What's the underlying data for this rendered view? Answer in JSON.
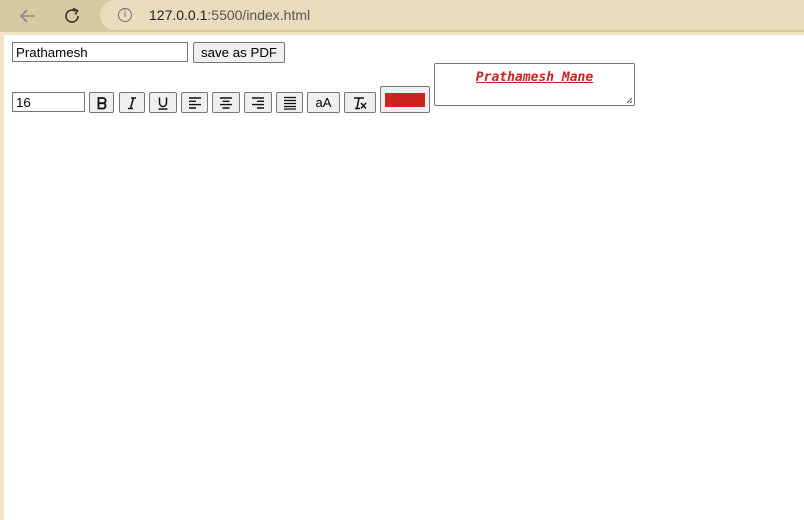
{
  "browser": {
    "url_host": "127.0.0.1",
    "url_path": ":5500/index.html",
    "info_icon": "i"
  },
  "toolbar": {
    "name_value": "Prathamesh",
    "save_pdf_label": "save as PDF",
    "font_size_value": "16",
    "case_label": "aA",
    "text_color": "#cc2222"
  },
  "preview": {
    "text": "Prathamesh Mane",
    "color": "#cc2222"
  }
}
